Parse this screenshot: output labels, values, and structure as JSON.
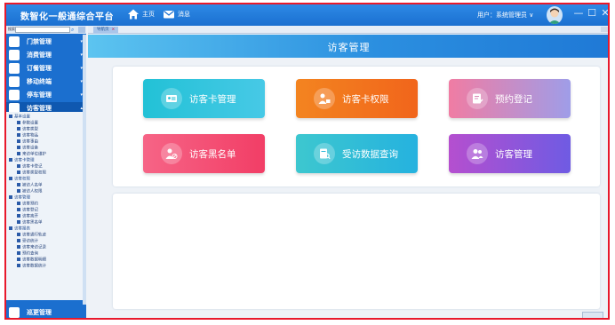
{
  "header": {
    "app_title": "数智化一般通综合平台",
    "nav_home": "主页",
    "nav_message": "消息",
    "user_text": "用户：系统管理员 ∨",
    "minimize": "—",
    "maximize": "☐",
    "close": "✕",
    "accent": "#1a6fd0"
  },
  "sidebar": {
    "search_label": "搜索",
    "menu": [
      {
        "label": "门禁管理",
        "icon": "door-icon"
      },
      {
        "label": "消费管理",
        "icon": "money-bag-icon"
      },
      {
        "label": "订餐管理",
        "icon": "meal-icon"
      },
      {
        "label": "移动终端",
        "icon": "mobile-icon"
      },
      {
        "label": "停车管理",
        "icon": "parking-icon"
      },
      {
        "label": "访客管理",
        "icon": "visitor-icon"
      }
    ],
    "tree": [
      {
        "label": "基本设置",
        "group": true
      },
      {
        "label": "参数设置"
      },
      {
        "label": "访客类型"
      },
      {
        "label": "访客物品"
      },
      {
        "label": "访客事由"
      },
      {
        "label": "访客设备"
      },
      {
        "label": "来访单位维护"
      },
      {
        "label": "访客卡管理",
        "group": true
      },
      {
        "label": "访客卡登记"
      },
      {
        "label": "访客类型权限"
      },
      {
        "label": "访客权限",
        "group": true
      },
      {
        "label": "被访人名单"
      },
      {
        "label": "被访人权限"
      },
      {
        "label": "访客管理",
        "group": true
      },
      {
        "label": "访客预约"
      },
      {
        "label": "访客登记"
      },
      {
        "label": "访客离开"
      },
      {
        "label": "访客黑名单"
      },
      {
        "label": "访客报表",
        "group": true
      },
      {
        "label": "访客通行轨迹"
      },
      {
        "label": "受访统计"
      },
      {
        "label": "访客来访记录"
      },
      {
        "label": "预约查询"
      },
      {
        "label": "访客数据明细"
      },
      {
        "label": "访客数据统计"
      }
    ],
    "bottom_item": "巡更管理"
  },
  "tabs": {
    "nav_tab": "导航页",
    "nav_tab_close": "×"
  },
  "main": {
    "title": "访客管理",
    "tiles": [
      {
        "label": "访客卡管理"
      },
      {
        "label": "访客卡权限"
      },
      {
        "label": "预约登记"
      },
      {
        "label": "访客黑名单"
      },
      {
        "label": "受访数据查询"
      },
      {
        "label": "访客管理"
      }
    ]
  }
}
